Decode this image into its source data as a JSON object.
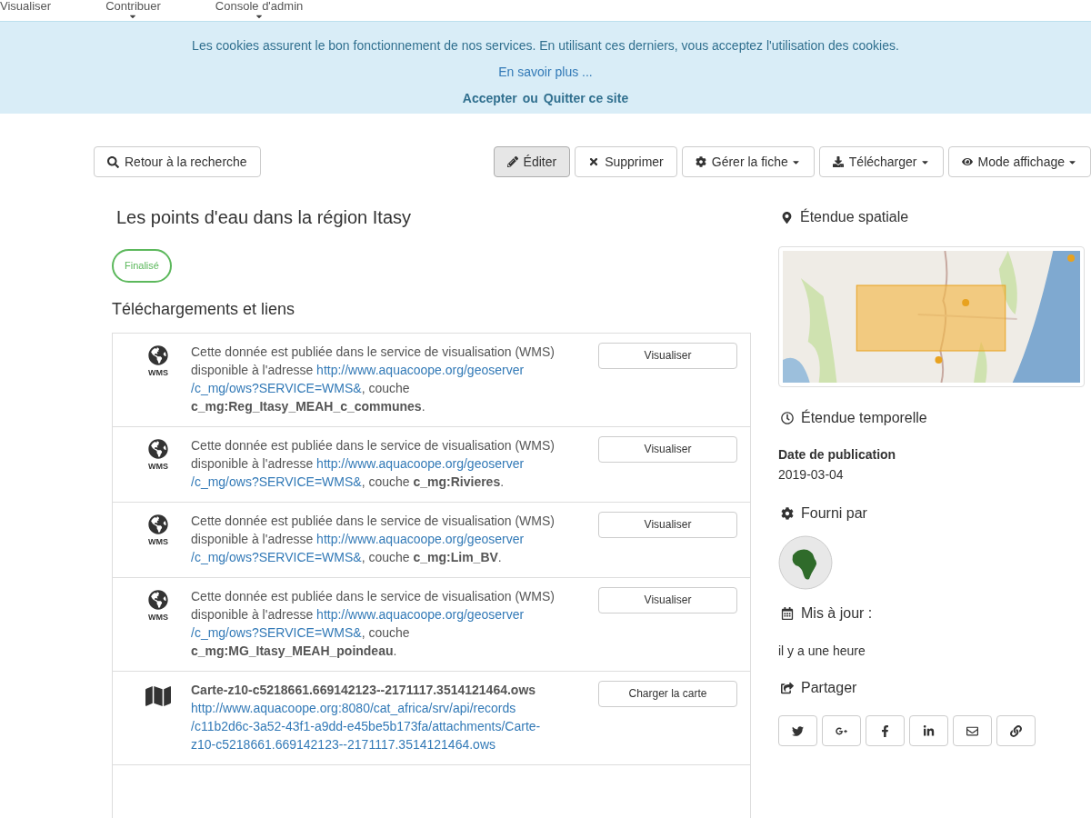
{
  "nav": [
    {
      "label": "Visualiser",
      "dropdown": false
    },
    {
      "label": "Contribuer",
      "dropdown": true
    },
    {
      "label": "Console d'admin",
      "dropdown": true
    }
  ],
  "cookie_banner": {
    "message": "Les cookies assurent le bon fonctionnement de nos services. En utilisant ces derniers, vous acceptez l'utilisation des cookies.",
    "more_link": "En savoir plus ...",
    "accept": "Accepter",
    "separator": "ou",
    "quit": "Quitter ce site"
  },
  "toolbar": {
    "back": "Retour à la recherche",
    "actions": [
      {
        "kind": "edit",
        "label": "Éditer",
        "dropdown": false,
        "hovered": true
      },
      {
        "kind": "delete",
        "label": "Supprimer",
        "dropdown": false,
        "hovered": false
      },
      {
        "kind": "manage",
        "label": "Gérer la fiche",
        "dropdown": true,
        "hovered": false
      },
      {
        "kind": "download",
        "label": "Télécharger",
        "dropdown": true,
        "hovered": false
      },
      {
        "kind": "view",
        "label": "Mode affichage",
        "dropdown": true,
        "hovered": false
      }
    ]
  },
  "record": {
    "title": "Les points d'eau dans la région Itasy",
    "status": "Finalisé",
    "links_heading": "Téléchargements et liens",
    "links": [
      {
        "kind": "wms",
        "icon_label": "WMS",
        "text_before": "Cette donnée est publiée dans le service de visualisation (WMS) disponible à l'adresse ",
        "url_lines": [
          "http://www.aquacoope.org/geoserver",
          "/c_mg/ows?SERVICE=WMS&"
        ],
        "text_after": ", couche **c_mg:Reg_Itasy_MEAH_c_communes**.",
        "button": "Visualiser"
      },
      {
        "kind": "wms",
        "icon_label": "WMS",
        "text_before": "Cette donnée est publiée dans le service de visualisation (WMS) disponible à l'adresse ",
        "url_lines": [
          "http://www.aquacoope.org/geoserver",
          "/c_mg/ows?SERVICE=WMS&"
        ],
        "text_after": ", couche **c_mg:Rivieres**.",
        "button": "Visualiser"
      },
      {
        "kind": "wms",
        "icon_label": "WMS",
        "text_before": "Cette donnée est publiée dans le service de visualisation (WMS) disponible à l'adresse ",
        "url_lines": [
          "http://www.aquacoope.org/geoserver",
          "/c_mg/ows?SERVICE=WMS&"
        ],
        "text_after": ", couche **c_mg:Lim_BV**.",
        "button": "Visualiser"
      },
      {
        "kind": "wms",
        "icon_label": "WMS",
        "text_before": "Cette donnée est publiée dans le service de visualisation (WMS) disponible à l'adresse ",
        "url_lines": [
          "http://www.aquacoope.org/geoserver",
          "/c_mg/ows?SERVICE=WMS&"
        ],
        "text_after": ", couche **c_mg:MG_Itasy_MEAH_poindeau**.",
        "button": "Visualiser"
      },
      {
        "kind": "map",
        "title": "Carte-z10-c5218661.669142123--2171117.3514121464.ows",
        "url_lines": [
          "http://www.aquacoope.org:8080/cat_africa/srv/api/records",
          "/c11b2d6c-3a52-43f1-a9dd-e45be5b173fa/attachments/Carte-",
          "z10-c5218661.669142123--2171117.3514121464.ows"
        ],
        "button": "Charger la carte"
      }
    ]
  },
  "sidebar": {
    "spatial_heading": "Étendue spatiale",
    "temporal_heading": "Étendue temporelle",
    "publication_label": "Date de publication",
    "publication_date": "2019-03-04",
    "provider_heading": "Fourni par",
    "updated_heading": "Mis à jour :",
    "updated_value": "il y a une heure",
    "share_heading": "Partager",
    "share_buttons": [
      {
        "kind": "twitter"
      },
      {
        "kind": "googleplus"
      },
      {
        "kind": "facebook"
      },
      {
        "kind": "linkedin"
      },
      {
        "kind": "email"
      },
      {
        "kind": "link"
      }
    ]
  }
}
